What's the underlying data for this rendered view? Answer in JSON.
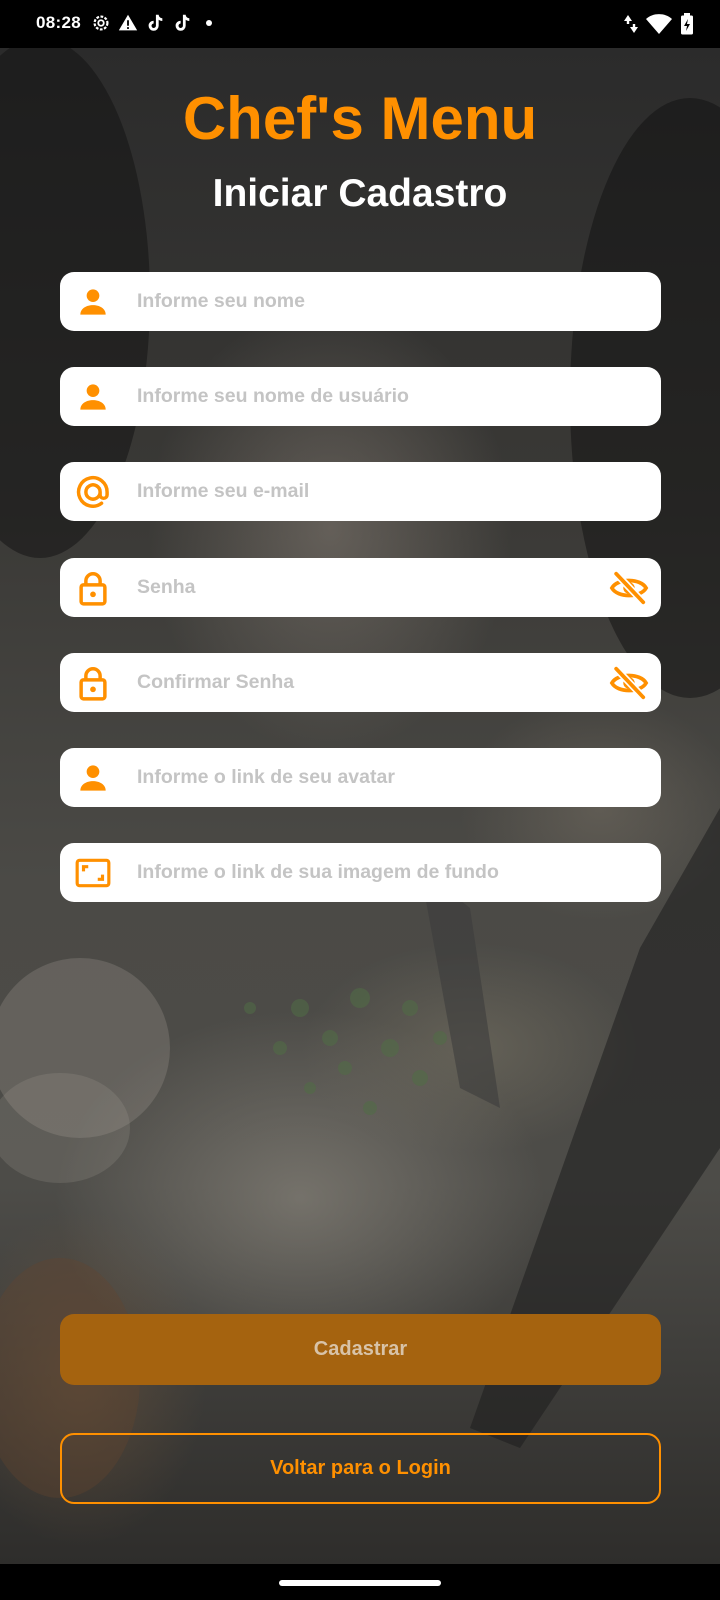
{
  "status_bar": {
    "time": "08:28",
    "left_icons": [
      "settings-gear-icon",
      "warning-icon",
      "tiktok-icon",
      "tiktok-icon",
      "notification-dot"
    ],
    "right_icons": [
      "data-arrows-icon",
      "wifi-icon",
      "battery-charging-icon"
    ]
  },
  "header": {
    "app_title": "Chef's Menu",
    "page_title": "Iniciar Cadastro"
  },
  "form": {
    "fields": [
      {
        "placeholder": "Informe seu nome",
        "icon": "person-icon",
        "value": ""
      },
      {
        "placeholder": "Informe seu nome de usuário",
        "icon": "person-icon",
        "value": ""
      },
      {
        "placeholder": "Informe seu e-mail",
        "icon": "at-sign-icon",
        "value": ""
      },
      {
        "placeholder": "Senha",
        "icon": "lock-icon",
        "trailing_icon": "eye-off-icon",
        "value": ""
      },
      {
        "placeholder": "Confirmar Senha",
        "icon": "lock-icon",
        "trailing_icon": "eye-off-icon",
        "value": ""
      },
      {
        "placeholder": "Informe o link de seu avatar",
        "icon": "person-icon",
        "value": ""
      },
      {
        "placeholder": "Informe o link de sua imagem de fundo",
        "icon": "aspect-ratio-icon",
        "value": ""
      }
    ]
  },
  "actions": {
    "submit_label": "Cadastrar",
    "back_label": "Voltar para o Login"
  },
  "colors": {
    "accent": "#ff9000",
    "field_bg": "#ffffff",
    "placeholder": "#c4c4c4",
    "submit_disabled_bg": "#a5630f"
  }
}
